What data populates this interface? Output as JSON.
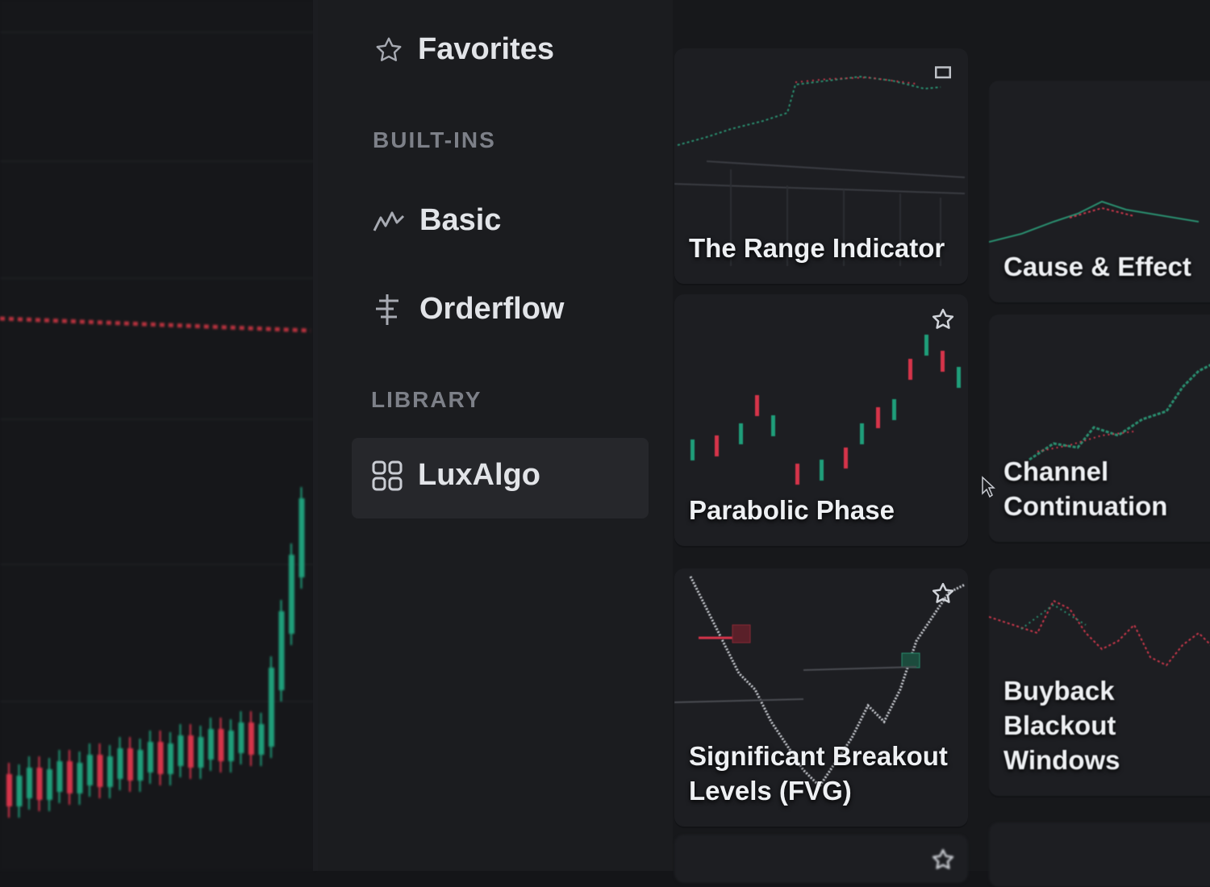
{
  "sidebar": {
    "favorites": "Favorites",
    "builtins_header": "BUILT-INS",
    "basic": "Basic",
    "orderflow": "Orderflow",
    "library_header": "LIBRARY",
    "luxalgo": "LuxAlgo"
  },
  "cards": [
    {
      "title": "The Range Indicator",
      "icon": "chart-thumbnail",
      "favorite_icon": "flag-icon"
    },
    {
      "title": "Cause & Effect",
      "icon": "chart-thumbnail"
    },
    {
      "title": "Parabolic Phase",
      "icon": "chart-thumbnail",
      "favorite_icon": "star-icon"
    },
    {
      "title": "Channel Continuation",
      "icon": "chart-thumbnail"
    },
    {
      "title": "Significant Breakout Levels (FVG)",
      "icon": "chart-thumbnail",
      "favorite_icon": "star-icon"
    },
    {
      "title": "Buyback Blackout Windows",
      "icon": "chart-thumbnail"
    }
  ],
  "colors": {
    "up": "#1f9e7a",
    "down": "#d6344a",
    "accent_bg": "#26272b",
    "text": "#e2e4e8",
    "muted": "#7d8088"
  }
}
